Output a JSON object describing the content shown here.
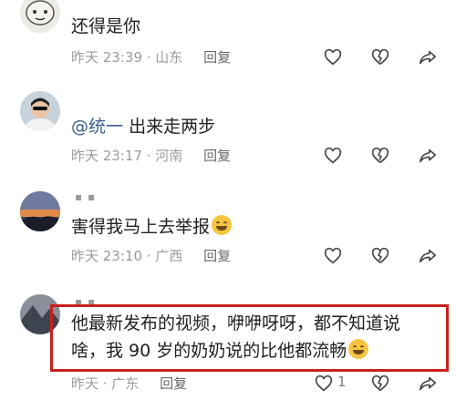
{
  "comments": [
    {
      "text": "还得是你",
      "time": "昨天 23:39 · 山东",
      "reply": "回复"
    },
    {
      "mention": "@统一",
      "text": "出来走两步",
      "time": "昨天 23:17 · 河南",
      "reply": "回复"
    },
    {
      "text": "害得我马上去举报",
      "emoji": "grin-emoji",
      "time": "昨天 23:10 · 广西",
      "reply": "回复"
    },
    {
      "text_line1": "他最新发布的视频，咿咿呀呀，都不知道说",
      "text_line2": "啥，我 90 岁的奶奶说的比他都流畅",
      "emoji": "laughing-tears-emoji",
      "time": "昨天 · 广东",
      "reply": "回复",
      "likes": "1"
    }
  ],
  "icons": {
    "like": "heart-outline-icon",
    "dislike": "broken-heart-icon",
    "share": "share-arrow-icon"
  },
  "colors": {
    "highlight_border": "#c9201c",
    "mention": "#3b5e8c",
    "meta": "#9b9b9b"
  }
}
